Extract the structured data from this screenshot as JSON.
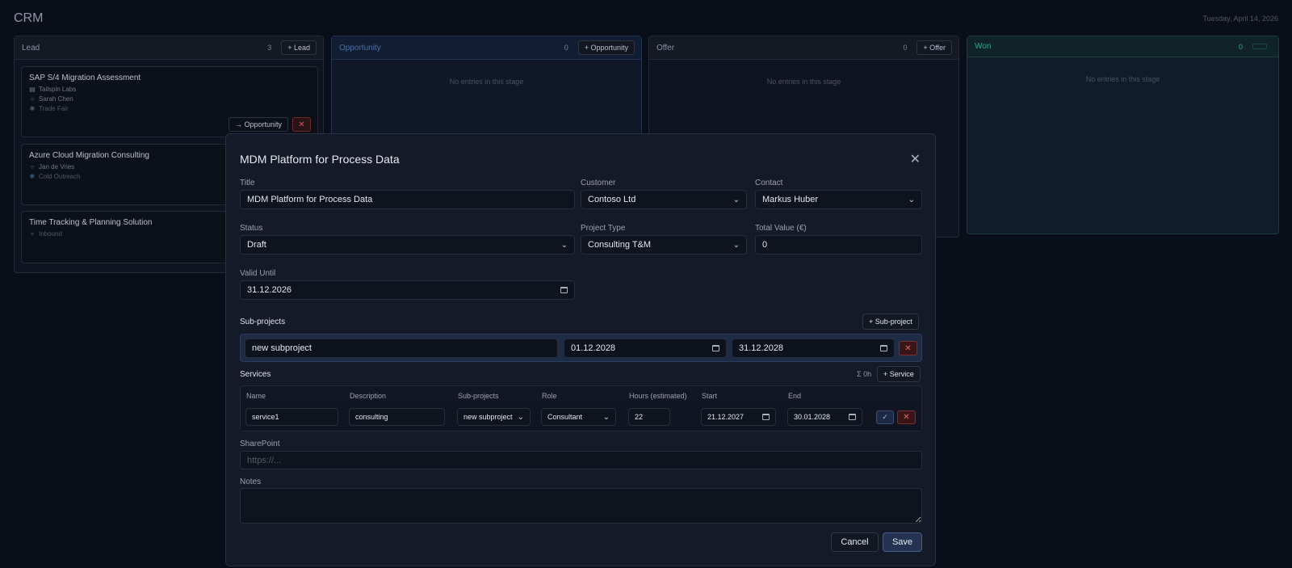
{
  "app": {
    "title": "CRM",
    "date": "Tuesday, April 14, 2026"
  },
  "board": {
    "empty_text": "No entries in this stage",
    "lead": {
      "name": "Lead",
      "count": "3",
      "add_label": "+ Lead",
      "cards": [
        {
          "title": "SAP S/4 Migration Assessment",
          "company": "Tailspin Labs",
          "contact": "Sarah Chen",
          "source": "Trade Fair",
          "move_label": "→ Opportunity"
        },
        {
          "title": "Azure Cloud Migration Consulting",
          "contact": "Jan de Vries",
          "source": "Cold Outreach"
        },
        {
          "title": "Time Tracking & Planning Solution",
          "source": "Inbound"
        }
      ]
    },
    "opportunity": {
      "name": "Opportunity",
      "count": "0",
      "add_label": "+ Opportunity"
    },
    "offer": {
      "name": "Offer",
      "count": "0",
      "add_label": "+ Offer"
    },
    "won": {
      "name": "Won",
      "count": "0"
    }
  },
  "modal": {
    "title": "MDM Platform for Process Data",
    "labels": {
      "title": "Title",
      "customer": "Customer",
      "contact": "Contact",
      "status": "Status",
      "project_type": "Project Type",
      "total_value": "Total Value (€)",
      "valid_until": "Valid Until",
      "sharepoint": "SharePoint",
      "notes": "Notes"
    },
    "values": {
      "title": "MDM Platform for Process Data",
      "customer": "Contoso Ltd",
      "contact": "Markus Huber",
      "status": "Draft",
      "project_type": "Consulting T&M",
      "total_value": "0",
      "valid_until": "31.12.2026"
    },
    "sharepoint_placeholder": "https://...",
    "subprojects": {
      "heading": "Sub-projects",
      "add_label": "+ Sub-project",
      "rows": [
        {
          "name": "new subproject",
          "start": "01.12.2028",
          "end": "31.12.2028"
        }
      ]
    },
    "services": {
      "heading": "Services",
      "sum": "Σ 0h",
      "add_label": "+ Service",
      "columns": [
        "Name",
        "Description",
        "Sub-projects",
        "Role",
        "Hours (estimated)",
        "Start",
        "End"
      ],
      "rows": [
        {
          "name": "service1",
          "description": "consulting",
          "subproject": "new subproject",
          "role": "Consultant",
          "hours": "22",
          "start": "21.12.2027",
          "end": "30.01.2028"
        }
      ]
    },
    "buttons": {
      "cancel": "Cancel",
      "save": "Save"
    }
  }
}
